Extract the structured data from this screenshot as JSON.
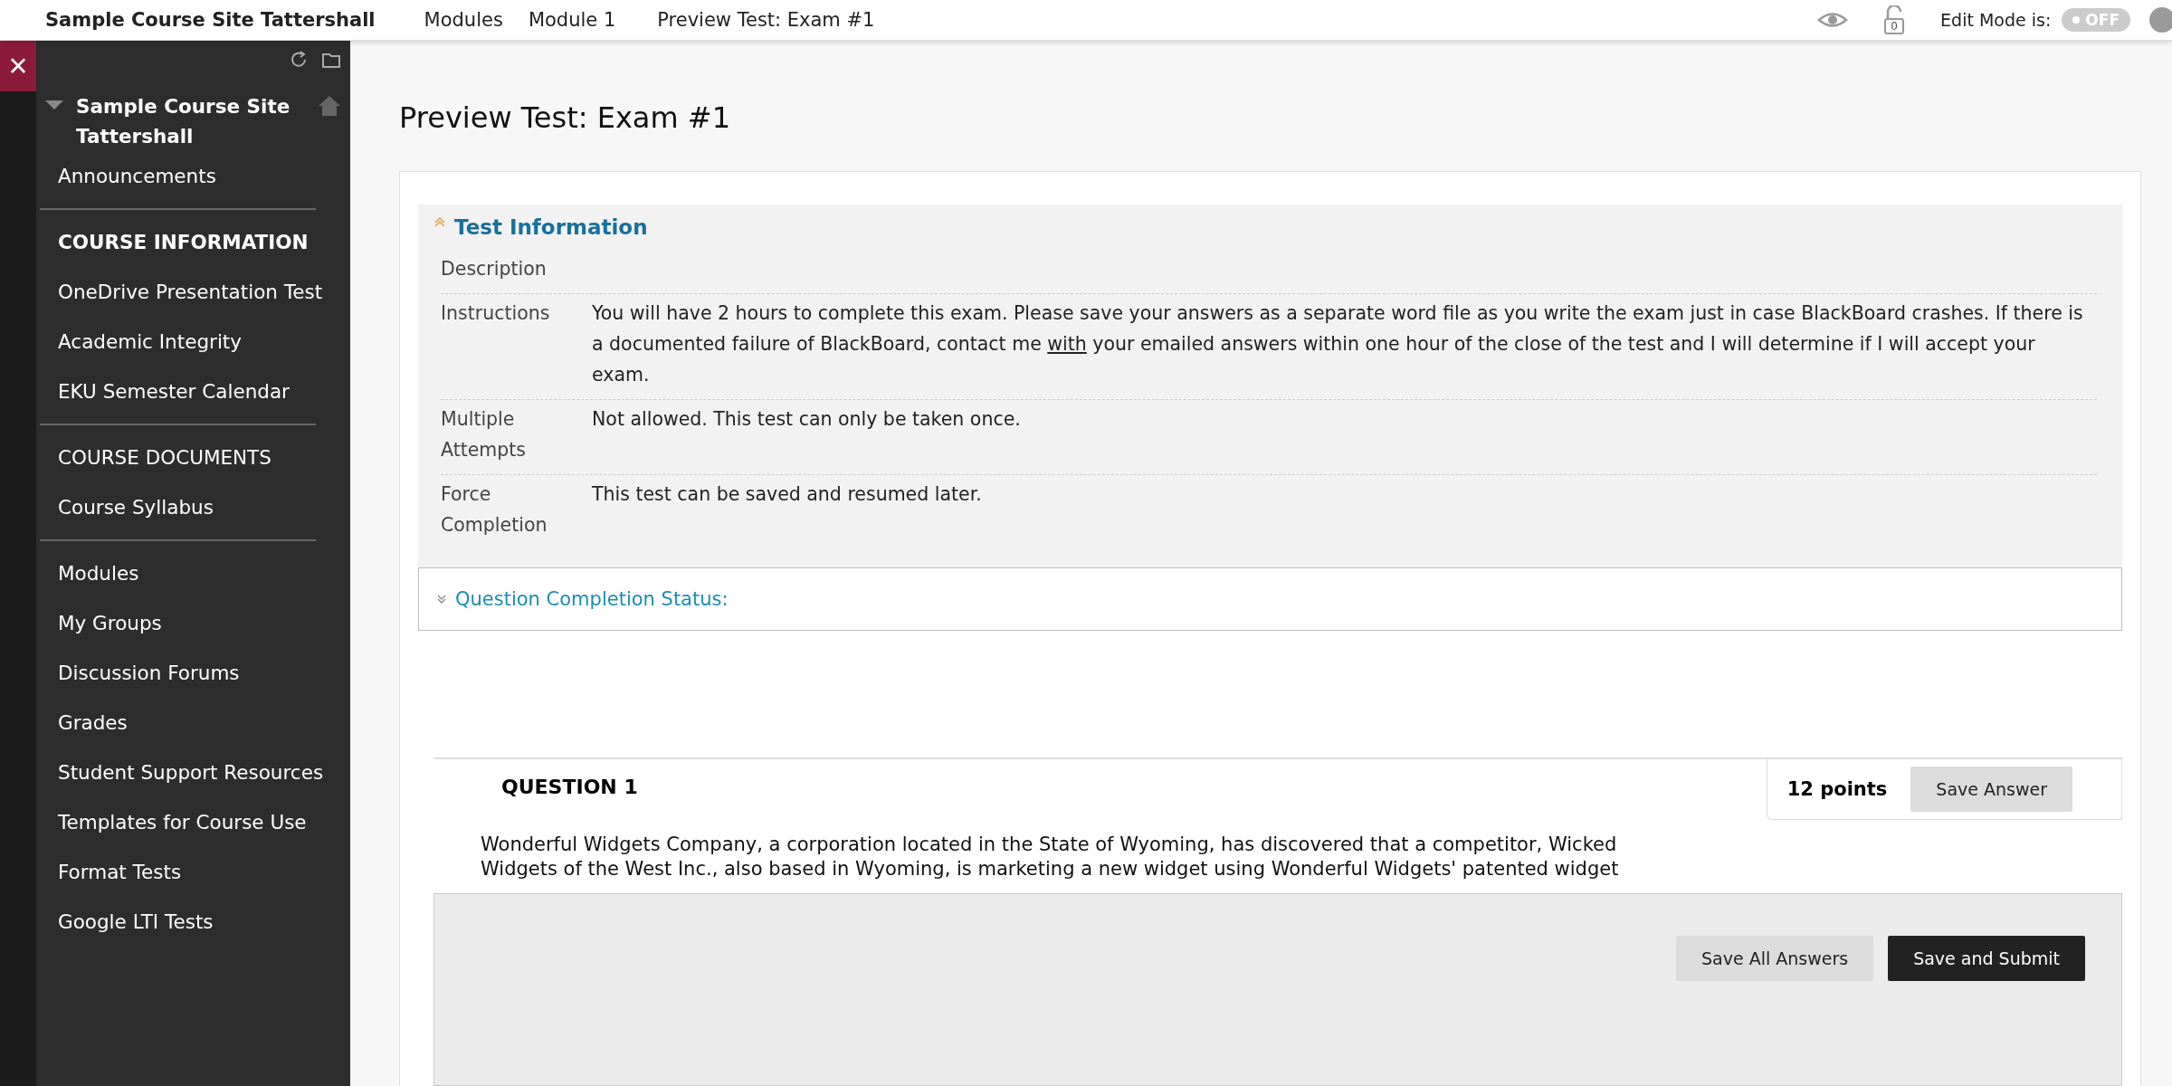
{
  "top_bar": {
    "course": "Sample Course Site Tattershall",
    "breadcrumbs": [
      "Modules",
      "Module 1",
      "Preview Test: Exam #1"
    ],
    "lock_count": "0",
    "edit_mode_label": "Edit Mode is:",
    "edit_mode": {
      "on": false,
      "label": "OFF"
    }
  },
  "close_button": "×",
  "sidebar": {
    "groups": [
      {
        "items": [
          {
            "kind": "title",
            "label": "Sample Course Site Tattershall"
          },
          {
            "kind": "link",
            "label": "Announcements"
          }
        ]
      },
      {
        "items": [
          {
            "kind": "heading",
            "label": "COURSE INFORMATION"
          },
          {
            "kind": "link",
            "label": "OneDrive Presentation Test"
          },
          {
            "kind": "link",
            "label": "Academic Integrity"
          },
          {
            "kind": "link",
            "label": "EKU Semester Calendar"
          }
        ]
      },
      {
        "items": [
          {
            "kind": "link",
            "label": "COURSE DOCUMENTS"
          },
          {
            "kind": "link",
            "label": "Course Syllabus"
          }
        ]
      },
      {
        "items": [
          {
            "kind": "link",
            "label": "Modules"
          },
          {
            "kind": "link",
            "label": "My Groups"
          },
          {
            "kind": "link",
            "label": "Discussion Forums"
          },
          {
            "kind": "link",
            "label": "Grades"
          },
          {
            "kind": "link",
            "label": "Student Support Resources"
          },
          {
            "kind": "link",
            "label": "Templates for Course Use"
          },
          {
            "kind": "link",
            "label": "Format Tests"
          },
          {
            "kind": "link",
            "label": "Google LTI Tests"
          }
        ]
      }
    ]
  },
  "page_title": "Preview Test: Exam #1",
  "test_information": {
    "title": "Test Information",
    "expanded": true,
    "rows": [
      {
        "label": "Description",
        "value": []
      },
      {
        "label": "Instructions",
        "value": [
          {
            "kind": "text",
            "text": "You will have 2 hours to complete this exam.  Please save your answers as a separate word file as you write the exam just in case BlackBoard crashes.  If there is a documented failure of BlackBoard, contact me "
          },
          {
            "kind": "link",
            "text": "with"
          },
          {
            "kind": "text",
            "text": " your emailed answers within one hour of the close of the test and I will determine if I will accept your exam."
          }
        ]
      },
      {
        "label": "Multiple Attempts",
        "value": [
          {
            "kind": "text",
            "text": "Not allowed. This test can only be taken once."
          }
        ]
      },
      {
        "label": "Force Completion",
        "value": [
          {
            "kind": "text",
            "text": "This test can be saved and resumed later."
          }
        ]
      }
    ]
  },
  "completion_status": {
    "title": "Question Completion Status:",
    "expanded": false
  },
  "question": {
    "title": "QUESTION 1",
    "points": "12 points",
    "save_button": "Save Answer",
    "lines": [
      "Wonderful Widgets Company, a corporation located in the State of Wyoming, has discovered that a competitor, Wicked",
      "Widgets of the West Inc., also based in Wyoming, is marketing a new widget using Wonderful Widgets' patented widget"
    ]
  },
  "footer_buttons": [
    {
      "kind": "secondary",
      "label": "Save All Answers"
    },
    {
      "kind": "primary",
      "label": "Save and Submit"
    }
  ]
}
